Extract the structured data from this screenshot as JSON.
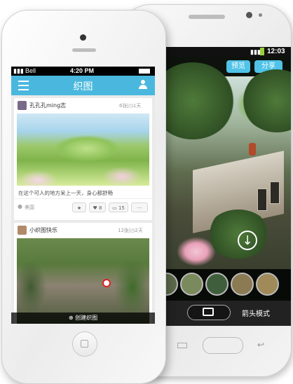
{
  "android": {
    "status": {
      "time": "12:03"
    },
    "topbar": {
      "preview_label": "预览",
      "share_label": "分享"
    },
    "bottom": {
      "mode_label": "箭头模式"
    }
  },
  "iphone": {
    "status": {
      "carrier": "Bell",
      "time": "4:20 PM"
    },
    "nav": {
      "title": "织图"
    },
    "posts": [
      {
        "username": "孔孔孔ming志",
        "meta": "6张|◷1天",
        "caption": "在这个可人的地方呆上一天，身心都舒畅",
        "location": "美国",
        "likes": "8",
        "comments": "15",
        "more": "···"
      },
      {
        "username": "小织图快乐",
        "meta": "12张|◷2天"
      }
    ],
    "create_label": "创建织图"
  }
}
